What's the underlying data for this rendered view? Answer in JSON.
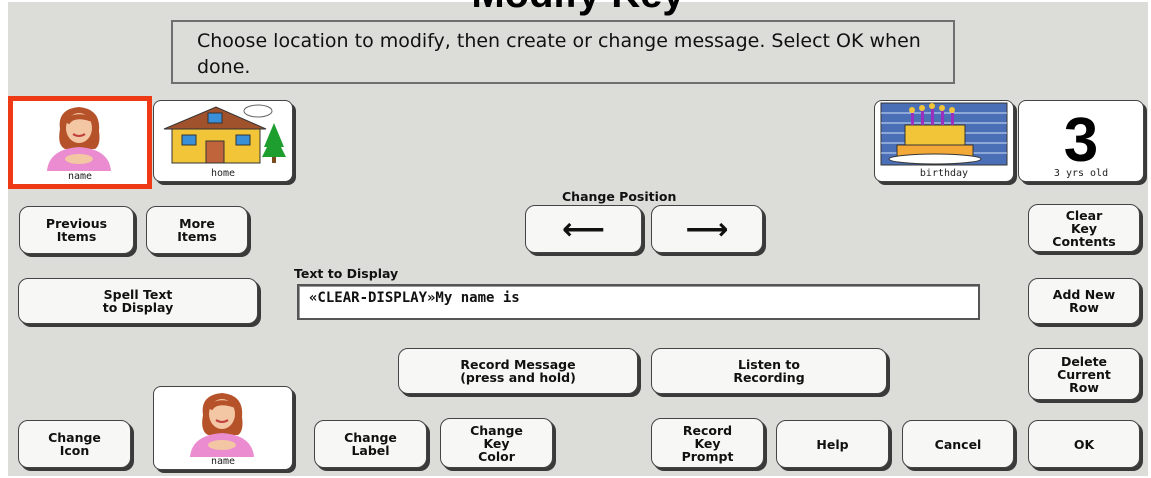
{
  "window": {
    "title_peek": "Modify Key"
  },
  "instruction": "Choose location to modify, then create or change message. Select OK when done.",
  "tiles": {
    "name": "name",
    "home": "home",
    "birthday": "birthday",
    "age": "3 yrs old",
    "age_symbol": "3"
  },
  "nav": {
    "previous": "Previous\nItems",
    "more": "More\nItems",
    "change_position": "Change Position",
    "left_arrow": "⟵",
    "right_arrow": "⟶",
    "clear": "Clear\nKey\nContents"
  },
  "text_display": {
    "label": "Text to Display",
    "value": "«CLEAR-DISPLAY»My name is"
  },
  "buttons": {
    "spell": "Spell Text\nto Display",
    "add_row": "Add New\nRow",
    "record": "Record Message\n(press and hold)",
    "listen": "Listen to\nRecording",
    "delete_row": "Delete\nCurrent\nRow",
    "change_icon": "Change\nIcon",
    "preview_caption": "name",
    "change_label": "Change\nLabel",
    "change_color": "Change\nKey\nColor",
    "record_prompt": "Record\nKey\nPrompt",
    "help": "Help",
    "cancel": "Cancel",
    "ok": "OK"
  },
  "colors": {
    "selection": "#ee3a14",
    "panel": "#dcdcd8"
  },
  "icons": [
    "person-icon",
    "house-icon",
    "birthday-cake-icon",
    "number-three-icon"
  ]
}
